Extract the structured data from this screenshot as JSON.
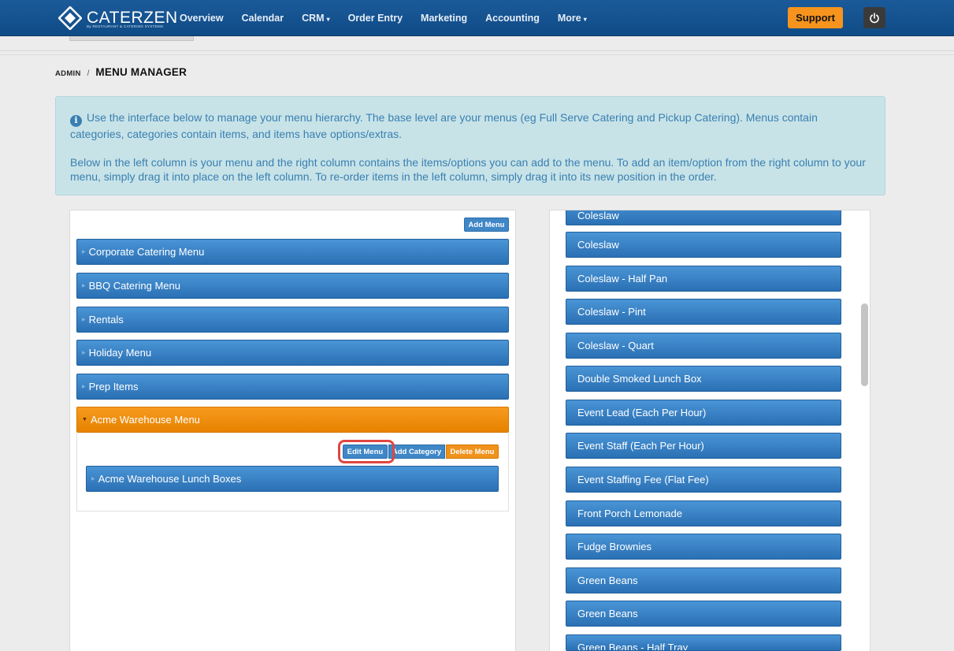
{
  "header": {
    "logo_text": "CATERZEN",
    "logo_tagline": "By RESTAURANT & CATERING SYSTEMS",
    "nav": [
      {
        "label": "Overview"
      },
      {
        "label": "Calendar"
      },
      {
        "label": "CRM",
        "caret": "▾"
      },
      {
        "label": "Order Entry"
      },
      {
        "label": "Marketing"
      },
      {
        "label": "Accounting"
      },
      {
        "label": "More",
        "caret": "▾"
      }
    ],
    "support_label": "Support",
    "power_icon": "power-icon"
  },
  "breadcrumb": {
    "parent": "ADMIN",
    "separator": "/",
    "current": "MENU MANAGER"
  },
  "info": {
    "icon": "i",
    "paragraph1": "Use the interface below to manage your menu hierarchy. The base level are your menus (eg Full Serve Catering and Pickup Catering). Menus contain categories, categories contain items, and items have options/extras.",
    "paragraph2": "Below in the left column is your menu and the right column contains the items/options you can add to the menu. To add an item/option from the right column to your menu, simply drag it into place on the left column. To re-order items in the left column, simply drag it into its new position in the order."
  },
  "left": {
    "add_menu_label": "Add Menu",
    "menus": [
      {
        "label": "Corporate Catering Menu"
      },
      {
        "label": "BBQ Catering Menu"
      },
      {
        "label": "Rentals"
      },
      {
        "label": "Holiday Menu"
      },
      {
        "label": "Prep Items"
      },
      {
        "label": "Acme Warehouse Menu",
        "active": true
      }
    ],
    "actions": {
      "edit_menu": "Edit Menu",
      "add_category": "Add Category",
      "delete_menu": "Delete Menu"
    },
    "categories": [
      {
        "label": "Acme Warehouse Lunch Boxes"
      }
    ]
  },
  "right": {
    "items": [
      "Coleslaw",
      "Coleslaw",
      "Coleslaw - Half Pan",
      "Coleslaw - Pint",
      "Coleslaw - Quart",
      "Double Smoked Lunch Box",
      "Event Lead (Each Per Hour)",
      "Event Staff (Each Per Hour)",
      "Event Staffing Fee (Flat Fee)",
      "Front Porch Lemonade",
      "Fudge Brownies",
      "Green Beans",
      "Green Beans",
      "Green Beans - Half Tray"
    ]
  },
  "colors": {
    "nav_bg": "#1b5a9a",
    "accent_blue": "#3f87c7",
    "accent_orange": "#f7941d",
    "highlight": "#e0463f"
  }
}
